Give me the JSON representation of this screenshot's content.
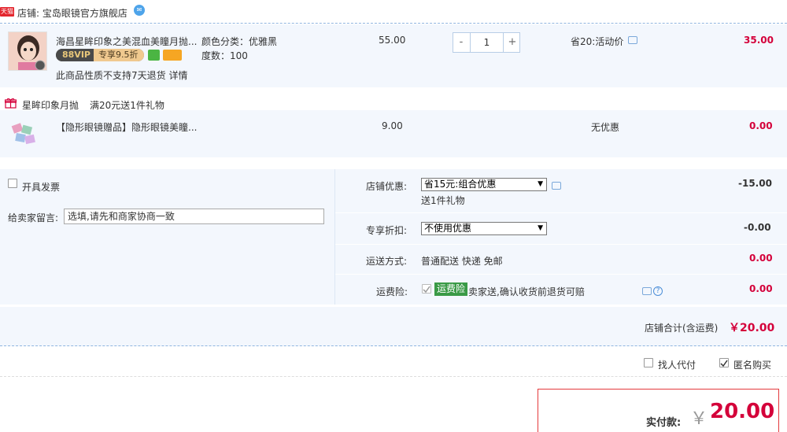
{
  "shop": {
    "badge": "天猫",
    "label": "店铺: 宝岛眼镜官方旗舰店",
    "ww_icon": "wangwang-chat-icon"
  },
  "item": {
    "title": "海昌星眸印象之美混血美瞳月抛...",
    "vip_left": "88VIP",
    "vip_right": "专享9.5折",
    "color_label": "颜色分类：优雅黑",
    "degree_label": "度数：100",
    "notice": "此商品性质不支持7天退货 详情",
    "unit_price": "55.00",
    "qty_minus": "-",
    "qty_value": "1",
    "qty_plus": "+",
    "promo": "省20:活动价",
    "subtotal": "35.00"
  },
  "gift_promo": {
    "name": "星眸印象月抛",
    "desc": "满20元送1件礼物"
  },
  "gift_item": {
    "title": "【隐形眼镜赠品】隐形眼镜美瞳...",
    "unit_price": "9.00",
    "promo": "无优惠",
    "subtotal": "0.00"
  },
  "options": {
    "invoice_label": "开具发票",
    "message_label": "给卖家留言:",
    "message_placeholder": "选填,请先和商家协商一致",
    "shop_discount_label": "店铺优惠:",
    "shop_discount_value": "省15元:组合优惠",
    "shop_discount_sub": "送1件礼物",
    "shop_discount_amount": "-15.00",
    "vip_discount_label": "专享折扣:",
    "vip_discount_value": "不使用优惠",
    "vip_discount_amount": "-0.00",
    "shipping_label": "运送方式:",
    "shipping_value": "普通配送 快递 免邮",
    "shipping_amount": "0.00",
    "insurance_label": "运费险:",
    "insurance_tag": "运费险",
    "insurance_desc": "卖家送,确认收货前退货可赔",
    "insurance_amount": "0.00",
    "help_glyph": "?"
  },
  "total": {
    "label": "店铺合计(含运费)",
    "amount": "￥20.00"
  },
  "extras": {
    "proxy_pay": "找人代付",
    "anonymous": "匿名购买"
  },
  "pay": {
    "label": "实付款:",
    "currency": "￥",
    "amount": "20.00"
  },
  "colors": {
    "accent_red": "#d4003a",
    "row_bg": "#f3f7fd",
    "border_blue": "#8fb5e0"
  }
}
